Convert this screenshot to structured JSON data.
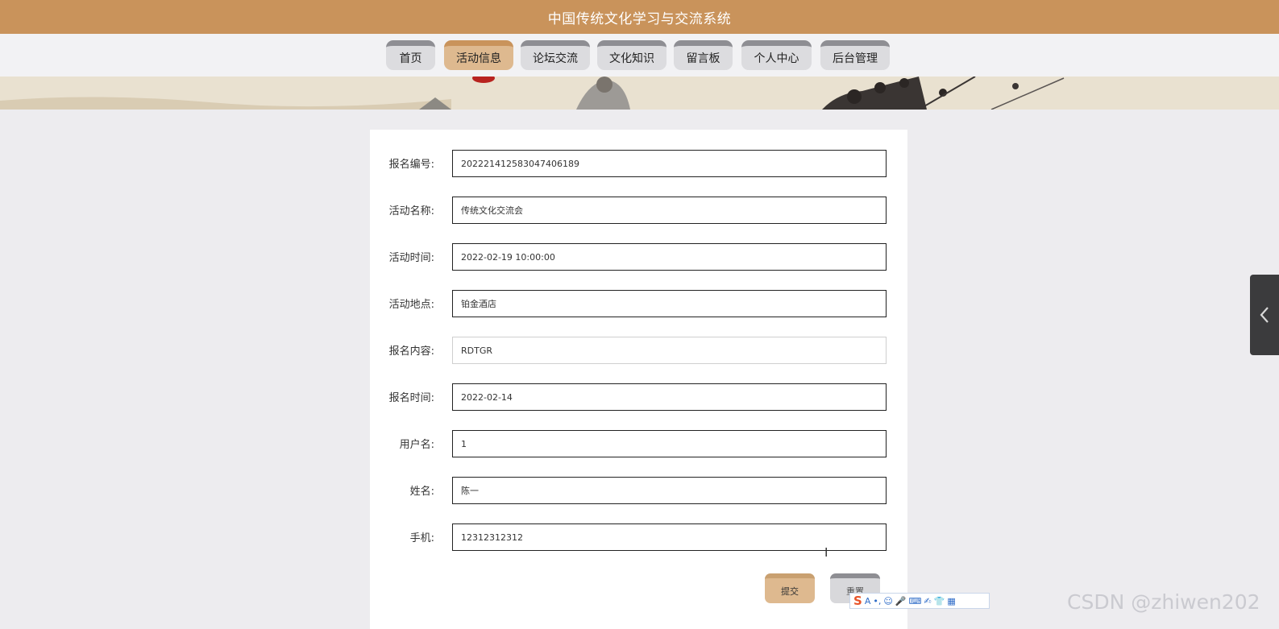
{
  "header": {
    "title": "中国传统文化学习与交流系统"
  },
  "nav": {
    "items": [
      {
        "label": "首页"
      },
      {
        "label": "活动信息"
      },
      {
        "label": "论坛交流"
      },
      {
        "label": "文化知识"
      },
      {
        "label": "留言板"
      },
      {
        "label": "个人中心"
      },
      {
        "label": "后台管理"
      }
    ],
    "active": "活动信息"
  },
  "form": {
    "fields": [
      {
        "label": "报名编号:",
        "value": "202221412583047406189"
      },
      {
        "label": "活动名称:",
        "value": "传统文化交流会"
      },
      {
        "label": "活动时间:",
        "value": "2022-02-19 10:00:00"
      },
      {
        "label": "活动地点:",
        "value": "铂金酒店"
      },
      {
        "label": "报名内容:",
        "value": "RDTGR"
      },
      {
        "label": "报名时间:",
        "value": "2022-02-14"
      },
      {
        "label": "用户名:",
        "value": "1"
      },
      {
        "label": "姓名:",
        "value": "陈一"
      },
      {
        "label": "手机:",
        "value": "12312312312"
      }
    ],
    "submit_label": "提交",
    "reset_label": "重置"
  },
  "side_tab": {
    "icon": "chevron-left-icon"
  },
  "watermark": {
    "text": "CSDN @zhiwen202"
  },
  "colors": {
    "brand": "#c9935b",
    "active_tab": "#deb98f",
    "tab": "#dcdcdf",
    "page_bg": "#edecef"
  }
}
